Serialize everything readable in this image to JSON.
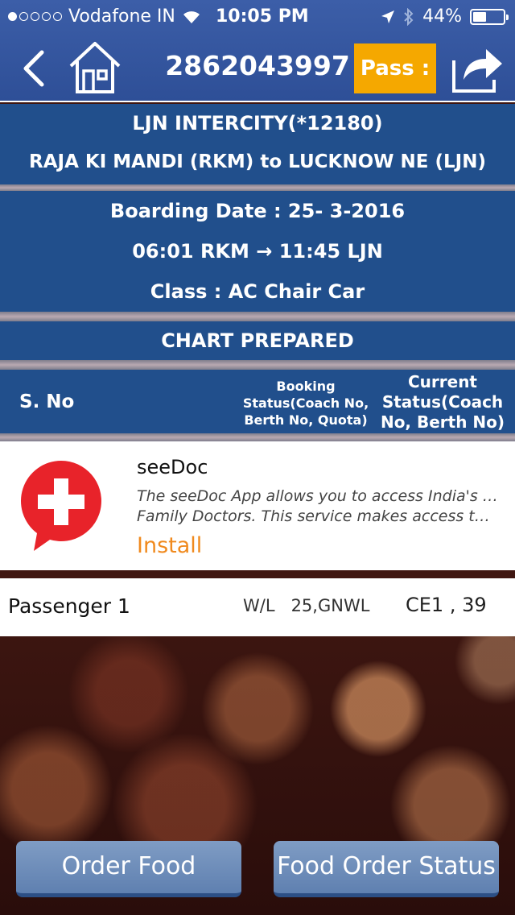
{
  "status_bar": {
    "carrier": "Vodafone IN",
    "time": "10:05 PM",
    "battery": "44%",
    "battery_level": 0.44,
    "signal_dots_filled": 1,
    "signal_dots_total": 5
  },
  "header": {
    "pnr": "2862043997",
    "pass_label": "Pass :"
  },
  "train": {
    "name": "LJN  INTERCITY(*12180)",
    "route": "RAJA KI MANDI (RKM) to LUCKNOW NE (LJN)"
  },
  "journey": {
    "boarding_date": "Boarding Date : 25- 3-2016",
    "timing": "06:01 RKM → 11:45 LJN",
    "class": "Class : AC Chair Car"
  },
  "chart_status": "CHART PREPARED",
  "table_headers": {
    "sno": "S. No",
    "booking_line1": "Booking",
    "booking_line2": "Status(Coach No,",
    "booking_line3": "Berth No, Quota)",
    "current_line1": "Current",
    "current_line2": "Status(Coach",
    "current_line3": "No, Berth No)"
  },
  "ad": {
    "title": "seeDoc",
    "desc_line1": "The seeDoc App allows you to access India's leading",
    "desc_line2": "Family Doctors. This service makes access to high q…",
    "install_label": "Install",
    "icon": "red-cross-chat-icon"
  },
  "passengers": [
    {
      "name": "Passenger 1",
      "booking_status": "W/L   25,GNWL",
      "current_status": "CE1 , 39"
    }
  ],
  "buttons": {
    "order_food": "Order Food",
    "food_order_status": "Food Order Status"
  },
  "colors": {
    "nav_blue": "#2e4f97",
    "info_blue": "#214f8c",
    "pass_orange": "#f5a800",
    "install_orange": "#f08a1e",
    "ad_icon_red": "#e8232a"
  }
}
